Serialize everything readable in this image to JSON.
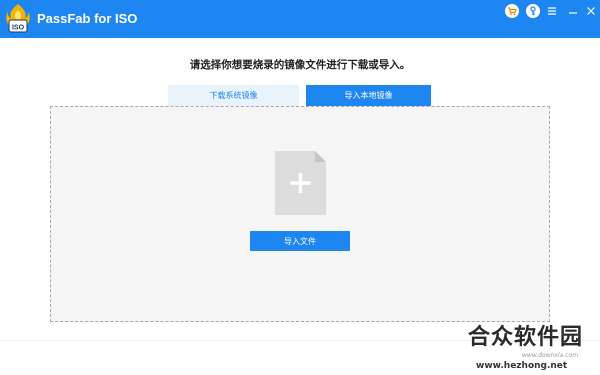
{
  "window": {
    "title": "PassFab for ISO",
    "logo_badge": "ISO",
    "controls": {
      "cart_icon": "cart-icon",
      "key_icon": "key-icon",
      "menu_icon": "hamburger-icon",
      "minimize_icon": "minimize-icon",
      "close_icon": "close-icon"
    }
  },
  "main": {
    "heading": "请选择你想要烧录的镜像文件进行下载或导入。",
    "tabs": [
      {
        "label": "下载系统镜像",
        "selected": false
      },
      {
        "label": "导入本地镜像",
        "selected": true
      }
    ],
    "dropzone": {
      "icon": "file-add-icon",
      "button_label": "导入文件"
    }
  },
  "watermark": {
    "logo_text": "合众软件园",
    "sub_text": "www.downxia.com",
    "url": "www.hezhong.net"
  },
  "colors": {
    "accent": "#1d86f0",
    "tab_inactive_bg": "#e8f3fc",
    "dropzone_bg": "#f5f5f5",
    "file_icon": "#dcdcdc"
  }
}
